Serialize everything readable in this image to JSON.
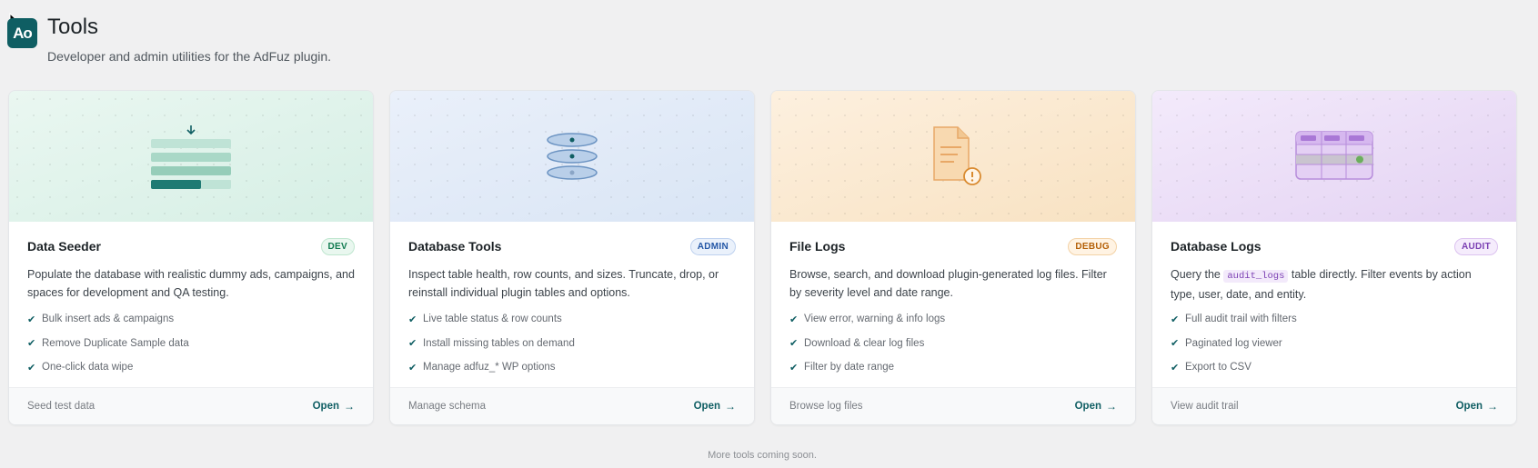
{
  "header": {
    "logo_text": "Ao",
    "title": "Tools",
    "subtitle": "Developer and admin utilities for the AdFuz plugin."
  },
  "cards": [
    {
      "title": "Data Seeder",
      "badge": "DEV",
      "description": "Populate the database with realistic dummy ads, campaigns, and spaces for development and QA testing.",
      "features": [
        "Bulk insert ads & campaigns",
        "Remove Duplicate Sample data",
        "One-click data wipe"
      ],
      "footer_note": "Seed test data",
      "open_label": "Open",
      "accent": "#0f7a4f",
      "illustration_icon": "seed-rows-icon"
    },
    {
      "title": "Database Tools",
      "badge": "ADMIN",
      "description": "Inspect table health, row counts, and sizes. Truncate, drop, or reinstall individual plugin tables and options.",
      "features": [
        "Live table status & row counts",
        "Install missing tables on demand",
        "Manage adfuz_* WP options"
      ],
      "footer_note": "Manage schema",
      "open_label": "Open",
      "accent": "#2457a6",
      "illustration_icon": "database-icon"
    },
    {
      "title": "File Logs",
      "badge": "DEBUG",
      "description": "Browse, search, and download plugin-generated log files. Filter by severity level and date range.",
      "features": [
        "View error, warning & info logs",
        "Download & clear log files",
        "Filter by date range"
      ],
      "footer_note": "Browse log files",
      "open_label": "Open",
      "accent": "#b45f06",
      "illustration_icon": "log-file-icon"
    },
    {
      "title": "Database Logs",
      "badge": "AUDIT",
      "description_before": "Query the",
      "description_code": "audit_logs",
      "description_after": "table directly. Filter events by action type, user, date, and entity.",
      "features": [
        "Full audit trail with filters",
        "Paginated log viewer",
        "Export to CSV"
      ],
      "footer_note": "View audit trail",
      "open_label": "Open",
      "accent": "#7b3fb3",
      "illustration_icon": "table-grid-icon"
    }
  ],
  "footer": {
    "more_text": "More tools coming soon."
  }
}
